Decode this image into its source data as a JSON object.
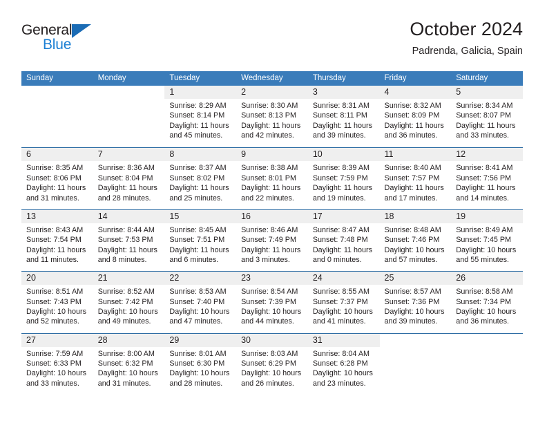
{
  "branding": {
    "logo_text_top": "General",
    "logo_text_bottom": "Blue",
    "logo_accent_color": "#1b7fd4"
  },
  "header": {
    "title": "October 2024",
    "subtitle": "Padrenda, Galicia, Spain"
  },
  "theme": {
    "header_bar_color": "#3a7cba",
    "row_divider_color": "#2e6da4",
    "day_band_color": "#efefef",
    "text_color": "#231f20"
  },
  "weekdays": [
    "Sunday",
    "Monday",
    "Tuesday",
    "Wednesday",
    "Thursday",
    "Friday",
    "Saturday"
  ],
  "weeks": [
    [
      {
        "day": "",
        "lines": []
      },
      {
        "day": "",
        "lines": []
      },
      {
        "day": "1",
        "lines": [
          "Sunrise: 8:29 AM",
          "Sunset: 8:14 PM",
          "Daylight: 11 hours",
          "and 45 minutes."
        ]
      },
      {
        "day": "2",
        "lines": [
          "Sunrise: 8:30 AM",
          "Sunset: 8:13 PM",
          "Daylight: 11 hours",
          "and 42 minutes."
        ]
      },
      {
        "day": "3",
        "lines": [
          "Sunrise: 8:31 AM",
          "Sunset: 8:11 PM",
          "Daylight: 11 hours",
          "and 39 minutes."
        ]
      },
      {
        "day": "4",
        "lines": [
          "Sunrise: 8:32 AM",
          "Sunset: 8:09 PM",
          "Daylight: 11 hours",
          "and 36 minutes."
        ]
      },
      {
        "day": "5",
        "lines": [
          "Sunrise: 8:34 AM",
          "Sunset: 8:07 PM",
          "Daylight: 11 hours",
          "and 33 minutes."
        ]
      }
    ],
    [
      {
        "day": "6",
        "lines": [
          "Sunrise: 8:35 AM",
          "Sunset: 8:06 PM",
          "Daylight: 11 hours",
          "and 31 minutes."
        ]
      },
      {
        "day": "7",
        "lines": [
          "Sunrise: 8:36 AM",
          "Sunset: 8:04 PM",
          "Daylight: 11 hours",
          "and 28 minutes."
        ]
      },
      {
        "day": "8",
        "lines": [
          "Sunrise: 8:37 AM",
          "Sunset: 8:02 PM",
          "Daylight: 11 hours",
          "and 25 minutes."
        ]
      },
      {
        "day": "9",
        "lines": [
          "Sunrise: 8:38 AM",
          "Sunset: 8:01 PM",
          "Daylight: 11 hours",
          "and 22 minutes."
        ]
      },
      {
        "day": "10",
        "lines": [
          "Sunrise: 8:39 AM",
          "Sunset: 7:59 PM",
          "Daylight: 11 hours",
          "and 19 minutes."
        ]
      },
      {
        "day": "11",
        "lines": [
          "Sunrise: 8:40 AM",
          "Sunset: 7:57 PM",
          "Daylight: 11 hours",
          "and 17 minutes."
        ]
      },
      {
        "day": "12",
        "lines": [
          "Sunrise: 8:41 AM",
          "Sunset: 7:56 PM",
          "Daylight: 11 hours",
          "and 14 minutes."
        ]
      }
    ],
    [
      {
        "day": "13",
        "lines": [
          "Sunrise: 8:43 AM",
          "Sunset: 7:54 PM",
          "Daylight: 11 hours",
          "and 11 minutes."
        ]
      },
      {
        "day": "14",
        "lines": [
          "Sunrise: 8:44 AM",
          "Sunset: 7:53 PM",
          "Daylight: 11 hours",
          "and 8 minutes."
        ]
      },
      {
        "day": "15",
        "lines": [
          "Sunrise: 8:45 AM",
          "Sunset: 7:51 PM",
          "Daylight: 11 hours",
          "and 6 minutes."
        ]
      },
      {
        "day": "16",
        "lines": [
          "Sunrise: 8:46 AM",
          "Sunset: 7:49 PM",
          "Daylight: 11 hours",
          "and 3 minutes."
        ]
      },
      {
        "day": "17",
        "lines": [
          "Sunrise: 8:47 AM",
          "Sunset: 7:48 PM",
          "Daylight: 11 hours",
          "and 0 minutes."
        ]
      },
      {
        "day": "18",
        "lines": [
          "Sunrise: 8:48 AM",
          "Sunset: 7:46 PM",
          "Daylight: 10 hours",
          "and 57 minutes."
        ]
      },
      {
        "day": "19",
        "lines": [
          "Sunrise: 8:49 AM",
          "Sunset: 7:45 PM",
          "Daylight: 10 hours",
          "and 55 minutes."
        ]
      }
    ],
    [
      {
        "day": "20",
        "lines": [
          "Sunrise: 8:51 AM",
          "Sunset: 7:43 PM",
          "Daylight: 10 hours",
          "and 52 minutes."
        ]
      },
      {
        "day": "21",
        "lines": [
          "Sunrise: 8:52 AM",
          "Sunset: 7:42 PM",
          "Daylight: 10 hours",
          "and 49 minutes."
        ]
      },
      {
        "day": "22",
        "lines": [
          "Sunrise: 8:53 AM",
          "Sunset: 7:40 PM",
          "Daylight: 10 hours",
          "and 47 minutes."
        ]
      },
      {
        "day": "23",
        "lines": [
          "Sunrise: 8:54 AM",
          "Sunset: 7:39 PM",
          "Daylight: 10 hours",
          "and 44 minutes."
        ]
      },
      {
        "day": "24",
        "lines": [
          "Sunrise: 8:55 AM",
          "Sunset: 7:37 PM",
          "Daylight: 10 hours",
          "and 41 minutes."
        ]
      },
      {
        "day": "25",
        "lines": [
          "Sunrise: 8:57 AM",
          "Sunset: 7:36 PM",
          "Daylight: 10 hours",
          "and 39 minutes."
        ]
      },
      {
        "day": "26",
        "lines": [
          "Sunrise: 8:58 AM",
          "Sunset: 7:34 PM",
          "Daylight: 10 hours",
          "and 36 minutes."
        ]
      }
    ],
    [
      {
        "day": "27",
        "lines": [
          "Sunrise: 7:59 AM",
          "Sunset: 6:33 PM",
          "Daylight: 10 hours",
          "and 33 minutes."
        ]
      },
      {
        "day": "28",
        "lines": [
          "Sunrise: 8:00 AM",
          "Sunset: 6:32 PM",
          "Daylight: 10 hours",
          "and 31 minutes."
        ]
      },
      {
        "day": "29",
        "lines": [
          "Sunrise: 8:01 AM",
          "Sunset: 6:30 PM",
          "Daylight: 10 hours",
          "and 28 minutes."
        ]
      },
      {
        "day": "30",
        "lines": [
          "Sunrise: 8:03 AM",
          "Sunset: 6:29 PM",
          "Daylight: 10 hours",
          "and 26 minutes."
        ]
      },
      {
        "day": "31",
        "lines": [
          "Sunrise: 8:04 AM",
          "Sunset: 6:28 PM",
          "Daylight: 10 hours",
          "and 23 minutes."
        ]
      },
      {
        "day": "",
        "lines": []
      },
      {
        "day": "",
        "lines": []
      }
    ]
  ]
}
